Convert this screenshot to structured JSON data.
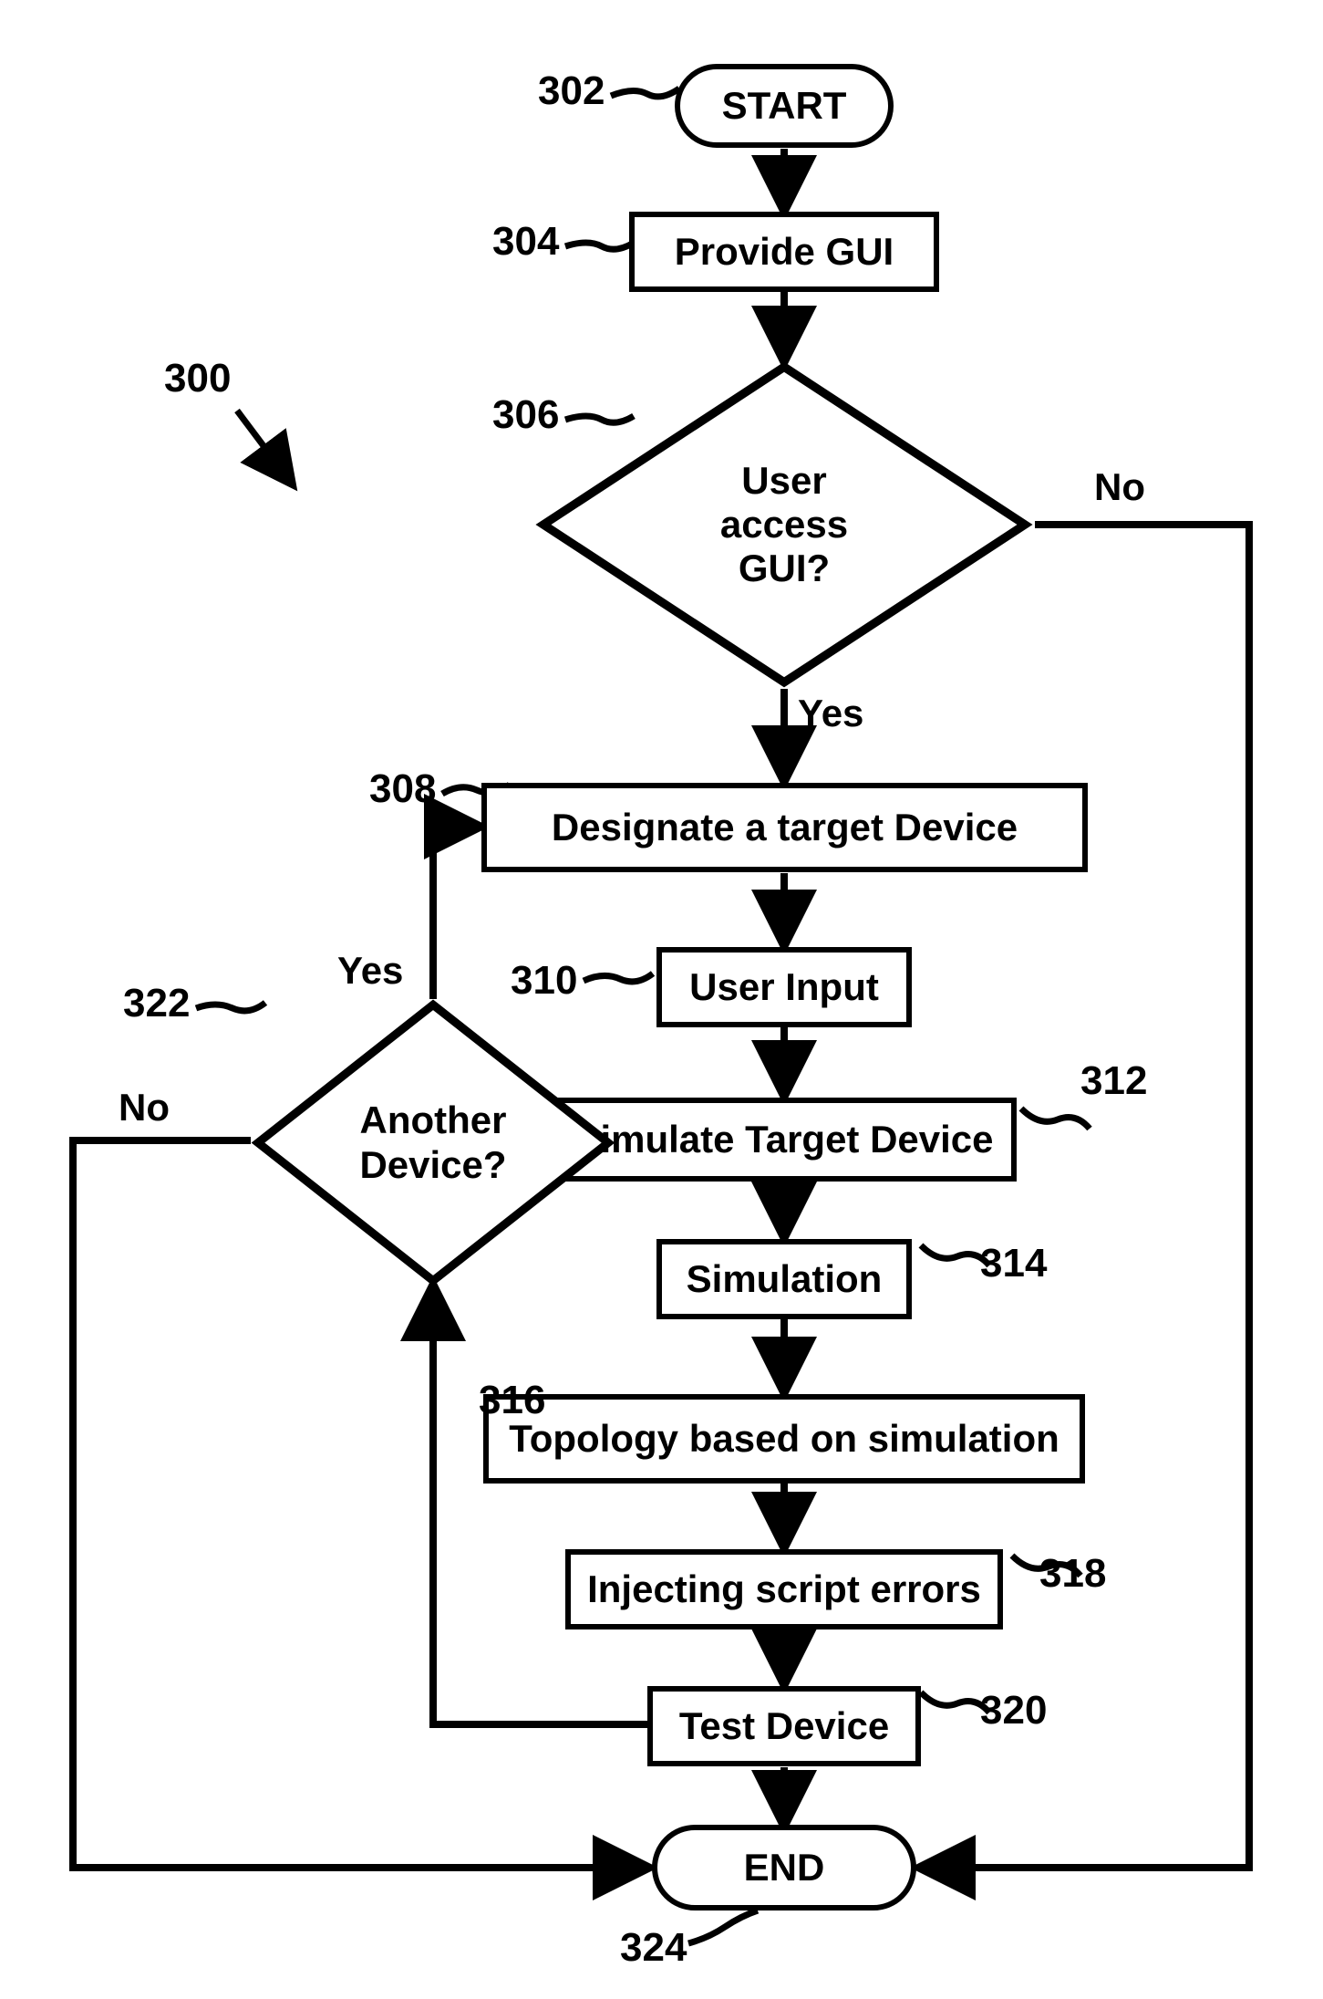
{
  "figure_ref": "300",
  "nodes": {
    "start": {
      "ref": "302",
      "text": "START"
    },
    "provide_gui": {
      "ref": "304",
      "text": "Provide GUI"
    },
    "user_access": {
      "ref": "306",
      "text": "User\naccess\nGUI?"
    },
    "designate": {
      "ref": "308",
      "text": "Designate a target Device"
    },
    "user_input": {
      "ref": "310",
      "text": "User Input"
    },
    "simulate": {
      "ref": "312",
      "text": "Simulate Target Device"
    },
    "simulation": {
      "ref": "314",
      "text": "Simulation"
    },
    "topology": {
      "ref": "316",
      "text": "Topology based on simulation"
    },
    "inject": {
      "ref": "318",
      "text": "Injecting script errors"
    },
    "test": {
      "ref": "320",
      "text": "Test Device"
    },
    "another": {
      "ref": "322",
      "text": "Another\nDevice?"
    },
    "end": {
      "ref": "324",
      "text": "END"
    }
  },
  "edge_labels": {
    "user_access_yes": "Yes",
    "user_access_no": "No",
    "another_yes": "Yes",
    "another_no": "No"
  }
}
